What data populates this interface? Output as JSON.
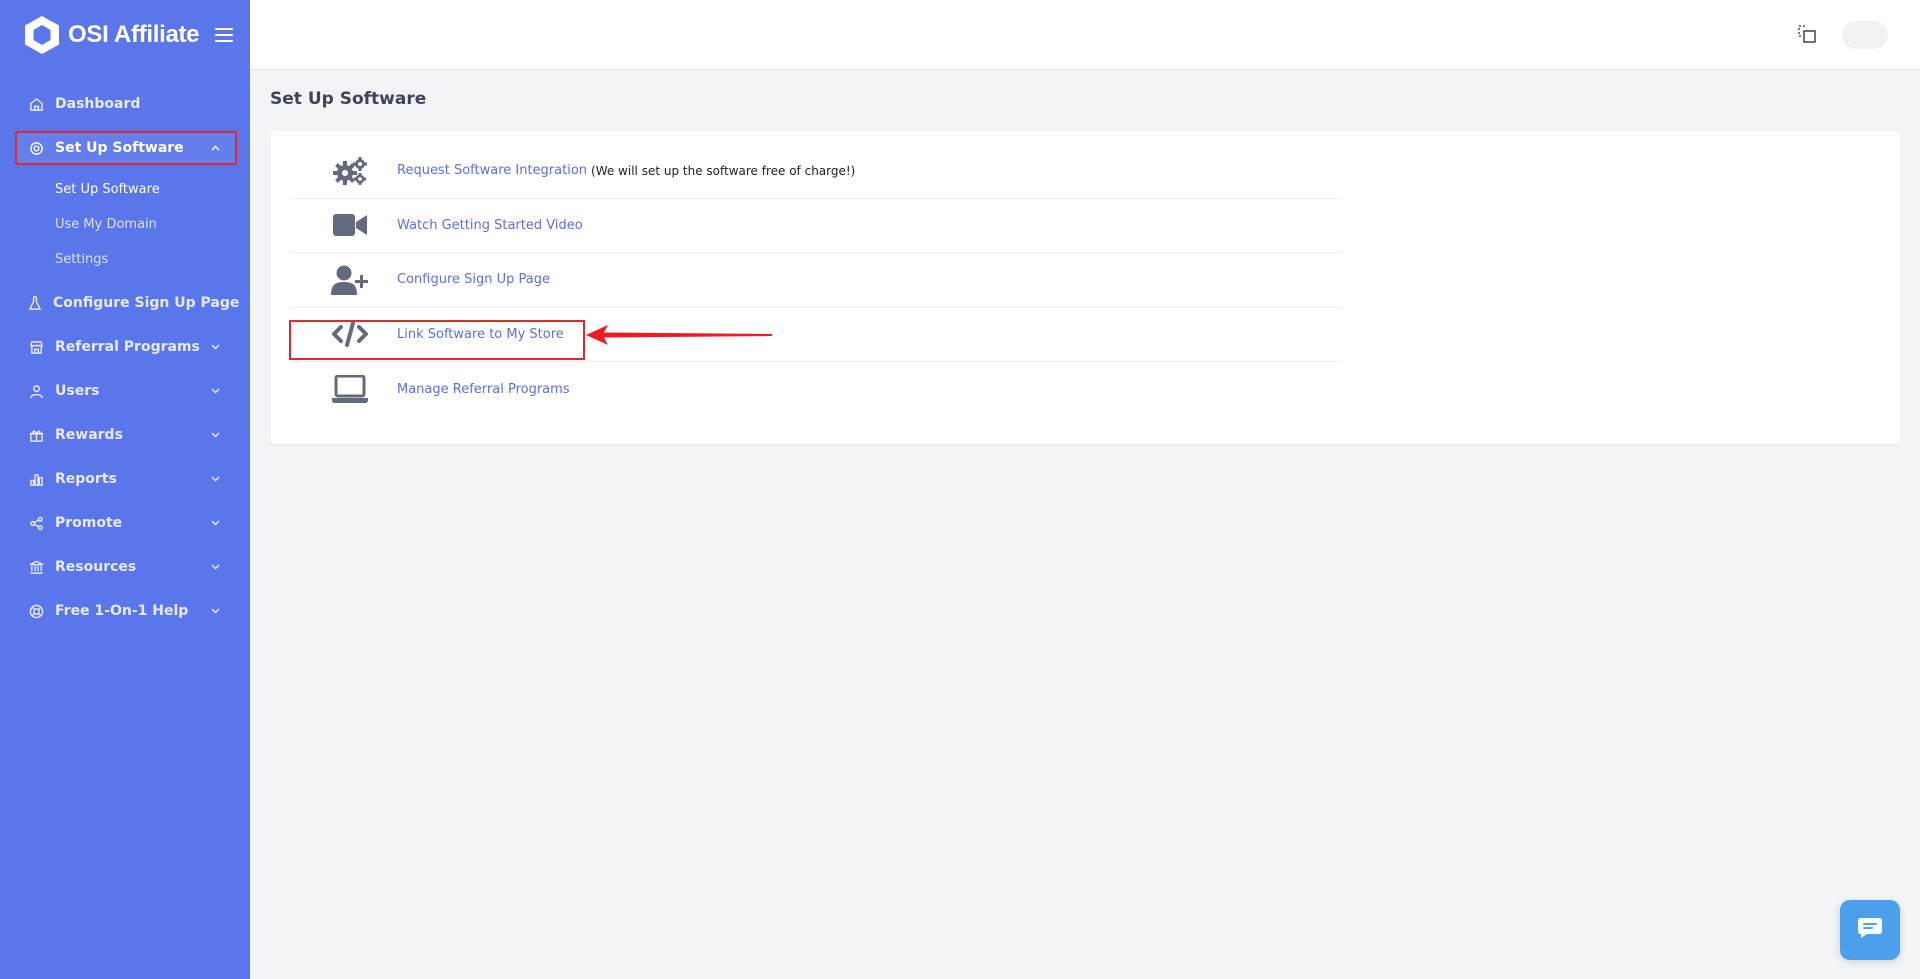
{
  "app": {
    "brand_name": "OSI Affiliate",
    "logo_icon": "hexagon-logo-icon",
    "menu_icon": "hamburger-menu-icon"
  },
  "sidebar": {
    "items": [
      {
        "label": "Dashboard",
        "icon": "home-icon"
      },
      {
        "label": "Set Up Software",
        "icon": "gear-icon",
        "expanded": true
      },
      {
        "label": "Configure Sign Up Page",
        "icon": "flask-icon"
      },
      {
        "label": "Referral Programs",
        "icon": "store-icon"
      },
      {
        "label": "Users",
        "icon": "user-icon"
      },
      {
        "label": "Rewards",
        "icon": "gift-icon"
      },
      {
        "label": "Reports",
        "icon": "bar-chart-icon"
      },
      {
        "label": "Promote",
        "icon": "share-icon"
      },
      {
        "label": "Resources",
        "icon": "bank-icon"
      },
      {
        "label": "Free 1-On-1 Help",
        "icon": "lifebuoy-icon"
      }
    ],
    "submenu": [
      "Set Up Software",
      "Use My Domain",
      "Settings"
    ]
  },
  "topbar": {
    "icon": "copy-window-icon"
  },
  "main": {
    "title": "Set Up Software",
    "rows": [
      {
        "label": "Request Software Integration",
        "note": "(We will set up the software free of charge!)",
        "icon": "gears-icon"
      },
      {
        "label": "Watch Getting Started Video",
        "note": "",
        "icon": "video-camera-icon"
      },
      {
        "label": "Configure Sign Up Page",
        "note": "",
        "icon": "user-plus-icon"
      },
      {
        "label": "Link Software to My Store",
        "note": "",
        "icon": "code-icon"
      },
      {
        "label": "Manage Referral Programs",
        "note": "",
        "icon": "laptop-icon"
      }
    ]
  },
  "annotation": {
    "highlight_color": "#e02a2e"
  },
  "colors": {
    "sidebar_bg": "#5b76ea",
    "link": "#5b6fdb",
    "chat_bg": "#4c9fea"
  },
  "chat": {
    "icon": "chat-bubble-icon"
  }
}
